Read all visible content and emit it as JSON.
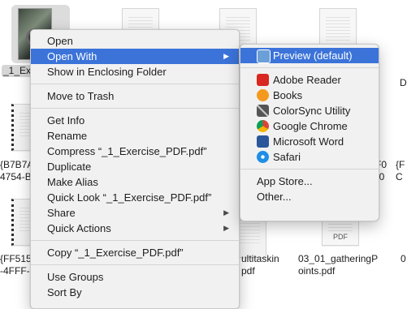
{
  "files": {
    "row1": [
      {
        "label": "_1_Exer",
        "selected": true,
        "icon": "photo-document-icon"
      },
      {
        "label": "",
        "icon": "document-icon"
      },
      {
        "label": "",
        "icon": "document-icon"
      },
      {
        "label": "",
        "icon": "document-icon"
      }
    ],
    "row1_right_label": "D",
    "row2": [
      {
        "label_line1": "{B7B7A",
        "label_line2": "4754-B"
      },
      {
        "label_line1": "{F0",
        "label_line2": "C0"
      },
      {
        "label_line1": "{F",
        "label_line2": "C"
      }
    ],
    "row3": [
      {
        "label_line1": "{FF515",
        "label_line2": "-4FFF-"
      },
      {
        "label_line1": "ultitaskin",
        "label_line2": "pdf"
      },
      {
        "label_line1": "03_01_gatheringP",
        "label_line2": "oints.pdf",
        "tag": "PDF"
      },
      {
        "label_line1": "0"
      }
    ]
  },
  "context_menu": {
    "items": [
      {
        "label": "Open"
      },
      {
        "label": "Open With",
        "submenu": true,
        "highlighted": true
      },
      {
        "label": "Show in Enclosing Folder"
      },
      {
        "label": "Move to Trash"
      },
      {
        "label": "Get Info"
      },
      {
        "label": "Rename"
      },
      {
        "label": "Compress “_1_Exercise_PDF.pdf”"
      },
      {
        "label": "Duplicate"
      },
      {
        "label": "Make Alias"
      },
      {
        "label": "Quick Look “_1_Exercise_PDF.pdf”"
      },
      {
        "label": "Share",
        "submenu": true
      },
      {
        "label": "Quick Actions",
        "submenu": true
      },
      {
        "label": "Copy “_1_Exercise_PDF.pdf”"
      },
      {
        "label": "Use Groups"
      },
      {
        "label": "Sort By"
      }
    ],
    "arrow_glyph": "▶"
  },
  "open_with_submenu": {
    "apps": [
      {
        "label": "Preview (default)",
        "icon": "preview-icon",
        "color": "#6b9fd8",
        "highlighted": true
      },
      {
        "label": "Adobe Reader",
        "icon": "adobe-reader-icon",
        "color": "#d8281f"
      },
      {
        "label": "Books",
        "icon": "books-icon",
        "color": "#f39a1e"
      },
      {
        "label": "ColorSync Utility",
        "icon": "colorsync-utility-icon",
        "color": "#555555"
      },
      {
        "label": "Google Chrome",
        "icon": "google-chrome-icon",
        "color": "#db4437"
      },
      {
        "label": "Microsoft Word",
        "icon": "microsoft-word-icon",
        "color": "#2b579a"
      },
      {
        "label": "Safari",
        "icon": "safari-icon",
        "color": "#1e8ee6"
      }
    ],
    "app_store": "App Store...",
    "other": "Other..."
  },
  "colors": {
    "highlight": "#3b73d9",
    "menu_bg": "#f1f1f1"
  }
}
